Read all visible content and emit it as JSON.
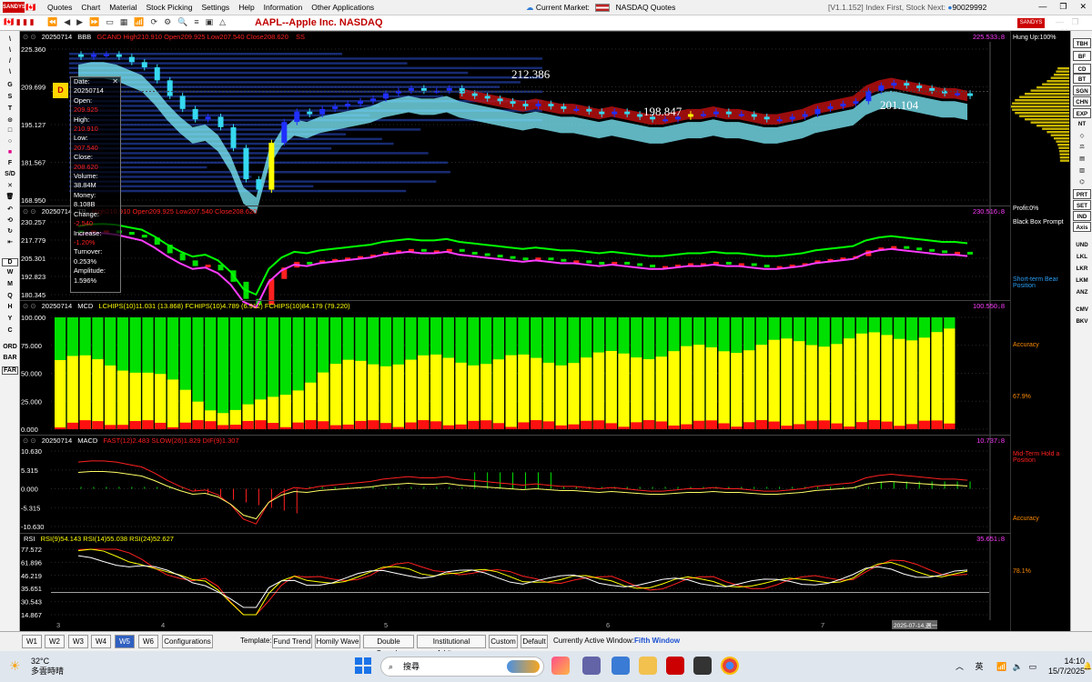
{
  "menubar": {
    "logo": "SANDYS",
    "menus": [
      "Quotes",
      "Chart",
      "Material",
      "Stock Picking",
      "Settings",
      "Help",
      "Information",
      "Other Applications"
    ],
    "symbol_title": "AAPL--Apple Inc.  NASDAQ",
    "current_market_label": "Current Market:",
    "current_market_value": "NASDAQ Quotes",
    "version_text": "[V1.1.152] Index First, Stock Next:",
    "account_id": "90029992"
  },
  "left_tools": [
    "\\",
    "\\",
    "/",
    "\\",
    "G",
    "S",
    "T",
    "⊙",
    "□",
    "○",
    "■",
    "F",
    "S/D",
    "✕",
    "🗑",
    "↶",
    "⟲",
    "↻",
    "⇤",
    "D",
    "W",
    "M",
    "Q",
    "H",
    "Y",
    "C",
    "ORD",
    "BAR",
    "FAR"
  ],
  "data_window": {
    "badge": "D",
    "rows": [
      {
        "t": "Date:",
        "c": "w"
      },
      {
        "t": "20250714",
        "c": "w"
      },
      {
        "t": "Open:",
        "c": "w"
      },
      {
        "t": "209.925",
        "c": "r"
      },
      {
        "t": "High:",
        "c": "w"
      },
      {
        "t": "210.910",
        "c": "r"
      },
      {
        "t": "Low:",
        "c": "w"
      },
      {
        "t": "207.540",
        "c": "r"
      },
      {
        "t": "Close:",
        "c": "w"
      },
      {
        "t": "208.620",
        "c": "r"
      },
      {
        "t": "Volume:",
        "c": "w"
      },
      {
        "t": "38.84M",
        "c": "w"
      },
      {
        "t": "Money:",
        "c": "w"
      },
      {
        "t": "8.108B",
        "c": "w"
      },
      {
        "t": "Change:",
        "c": "w"
      },
      {
        "t": "-2.540",
        "c": "r"
      },
      {
        "t": "Increase:",
        "c": "w"
      },
      {
        "t": "-1.20%",
        "c": "r"
      },
      {
        "t": "Turnover:",
        "c": "w"
      },
      {
        "t": "0.253%",
        "c": "w"
      },
      {
        "t": "Amplitude:",
        "c": "w"
      },
      {
        "t": "1.596%",
        "c": "w"
      }
    ]
  },
  "panes": {
    "bbb": {
      "head_date": "20250714",
      "name": "BBB",
      "head_values": "GCAND High210.910 Open209.925 Low207.540 Close208.620",
      "head_tail": "SS",
      "right_value": "225.533↓8",
      "yticks": [
        "225.360",
        "209.699",
        "195.127",
        "181.567",
        "168.950"
      ],
      "annotations": [
        "212.386",
        "198.847",
        "201.104"
      ]
    },
    "tb": {
      "head_date": "20250714",
      "name": "TB",
      "head_values": "High210.910 Open209.925 Low207.540 Close208.620",
      "right_value": "230.516↓8",
      "yticks": [
        "230.257",
        "217.779",
        "205.301",
        "192.823",
        "180.345"
      ]
    },
    "mcd": {
      "head_date": "20250714",
      "name": "MCD",
      "head_values": "LCHIPS(10)11.031 (13.868) FCHIPS(10)4.789 (6.912) FCHIPS(10)84.179 (79.220)",
      "right_value": "100.550↓8",
      "yticks": [
        "100.000",
        "75.000",
        "50.000",
        "25.000",
        "0.000"
      ]
    },
    "macd": {
      "head_date": "20250714",
      "name": "MACD",
      "head_values": "FAST(12)2.483 SLOW(26)1.829 DIF(9)1.307",
      "right_value": "10.737↓8",
      "yticks": [
        "10.630",
        "5.315",
        "0.000",
        "-5.315",
        "-10.630"
      ]
    },
    "rsi": {
      "name": "RSI",
      "head_values": "RSI(9)54.143 RSI(14)55.038 RSI(24)52.627",
      "right_value": "35.651↓8",
      "yticks": [
        "77.572",
        "61.896",
        "46.219",
        "35.651",
        "30.543",
        "14.867"
      ]
    },
    "xaxis": [
      "3",
      "4",
      "5",
      "6",
      "7"
    ],
    "cursor_date": "2025-07-14,週一"
  },
  "right_panel": {
    "hung_up": "Hung Up:100%",
    "profit": "Profit:0%",
    "black_box": "Black Box Prompt",
    "short_term": "Short-term Bear Position",
    "accuracy1": "Accuracy",
    "accuracy1_val": "67.9%",
    "mid_term": "Mid-Term Hold a Position",
    "accuracy2": "Accuracy",
    "accuracy2_val": "78.1%"
  },
  "right_buttons": [
    "TBH",
    "BF",
    "CD",
    "BT",
    "SGN",
    "CHN",
    "EXP",
    "NT",
    "◇",
    "⚖",
    "▤",
    "▥",
    "⌬",
    "PRT",
    "SET",
    "IND",
    "Axis",
    "UND",
    "LKL",
    "LKR",
    "LKM",
    "ANZ",
    "CMV",
    "BKV"
  ],
  "tabs": {
    "windows": [
      "W1",
      "W2",
      "W3",
      "W4",
      "W5",
      "W6"
    ],
    "active": "W5",
    "configurations": "Configurations",
    "template_label": "Template:",
    "templates": [
      "Fund Trend",
      "Homily Wave",
      "Double Swords",
      "Institutional Arbitrage",
      "Custom",
      "Default"
    ],
    "active_window_label": "Currently Active Window:",
    "active_window_value": "Fifth Window"
  },
  "taskbar": {
    "temp": "32°C",
    "weather": "多雲時晴",
    "search": "搜尋",
    "ime": "英",
    "time": "14:10",
    "date": "15/7/2025"
  },
  "colors": {
    "up": "#ff2020",
    "down": "#00e000",
    "cyan_band": "#7ff0ff",
    "yellow": "#ffff00",
    "magenta": "#ff3cff"
  },
  "chart_data": {
    "type": "candlestick",
    "closes_approx": [
      223,
      224,
      224,
      223,
      221,
      219,
      214,
      208,
      203,
      199,
      200,
      196,
      188,
      176,
      172,
      190,
      198,
      202,
      201,
      203,
      204,
      205,
      206,
      207,
      209,
      210,
      211,
      210,
      210,
      211,
      209,
      208,
      207,
      206,
      205,
      204,
      205,
      204,
      203,
      203,
      202,
      201,
      202,
      201,
      200,
      199,
      199,
      200,
      201,
      201,
      202,
      201,
      201,
      200,
      199,
      199,
      200,
      201,
      203,
      204,
      205,
      206,
      210,
      212,
      213,
      212,
      211,
      210,
      209,
      209,
      208
    ]
  }
}
